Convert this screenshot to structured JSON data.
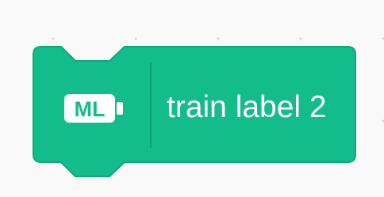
{
  "block": {
    "icon": "ml-icon",
    "icon_text": "ML",
    "label": "train label 2",
    "fill_color": "#13bd8b",
    "border_color": "#0fa87a",
    "divider_color": "#0f9f74",
    "text_color": "#ffffff"
  }
}
